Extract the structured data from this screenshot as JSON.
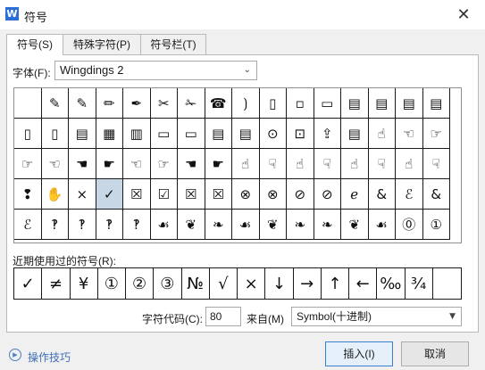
{
  "window": {
    "title": "符号",
    "app_icon_letter": "W",
    "close_glyph": "✕"
  },
  "tabs": [
    {
      "label": "符号(S)"
    },
    {
      "label": "特殊字符(P)"
    },
    {
      "label": "符号栏(T)"
    }
  ],
  "font": {
    "label": "字体(F):",
    "value": "Wingdings 2",
    "arrow": "⌄"
  },
  "symbol_grid": {
    "selected_index": 51,
    "rows": [
      [
        "",
        "✎",
        "✎",
        "✏",
        "✒",
        "✂",
        "✁",
        "☎",
        "⟯",
        "▯",
        "▫",
        "▭",
        "▤",
        "▤",
        "▤",
        "▤"
      ],
      [
        "▯",
        "▯",
        "▤",
        "▦",
        "▥",
        "▭",
        "▭",
        "▤",
        "▤",
        "⊙",
        "⊡",
        "⇪",
        "▤",
        "☝",
        "☜",
        "☞"
      ],
      [
        "☞",
        "☜",
        "☚",
        "☛",
        "☜",
        "☞",
        "☚",
        "☛",
        "☝",
        "☟",
        "☝",
        "☟",
        "☝",
        "☟",
        "☝",
        "☟"
      ],
      [
        "❢",
        "✋",
        "×",
        "✓",
        "☒",
        "☑",
        "☒",
        "☒",
        "⊗",
        "⊗",
        "⊘",
        "⊘",
        "ℯ",
        "&",
        "ℰ",
        "&"
      ],
      [
        "ℰ",
        "‽",
        "‽",
        "‽",
        "‽",
        "☙",
        "❦",
        "❧",
        "☙",
        "❦",
        "❧",
        "❧",
        "❦",
        "☙",
        "⓪",
        "①"
      ]
    ],
    "scroll_up": "▲",
    "scroll_down": "▼"
  },
  "recent": {
    "label": "近期使用过的符号(R):",
    "items": [
      "✓",
      "≠",
      "¥",
      "①",
      "②",
      "③",
      "№",
      "√",
      "×",
      "↓",
      "→",
      "↑",
      "←",
      "‰",
      "¾",
      ""
    ]
  },
  "code": {
    "label": "字符代码(C):",
    "value": "80"
  },
  "from": {
    "label": "来自(M)",
    "value": "Symbol(十进制)",
    "arrow": "▼"
  },
  "tips": {
    "icon_glyph": "▶",
    "label": "操作技巧"
  },
  "buttons": {
    "insert": "插入(I)",
    "cancel": "取消"
  }
}
